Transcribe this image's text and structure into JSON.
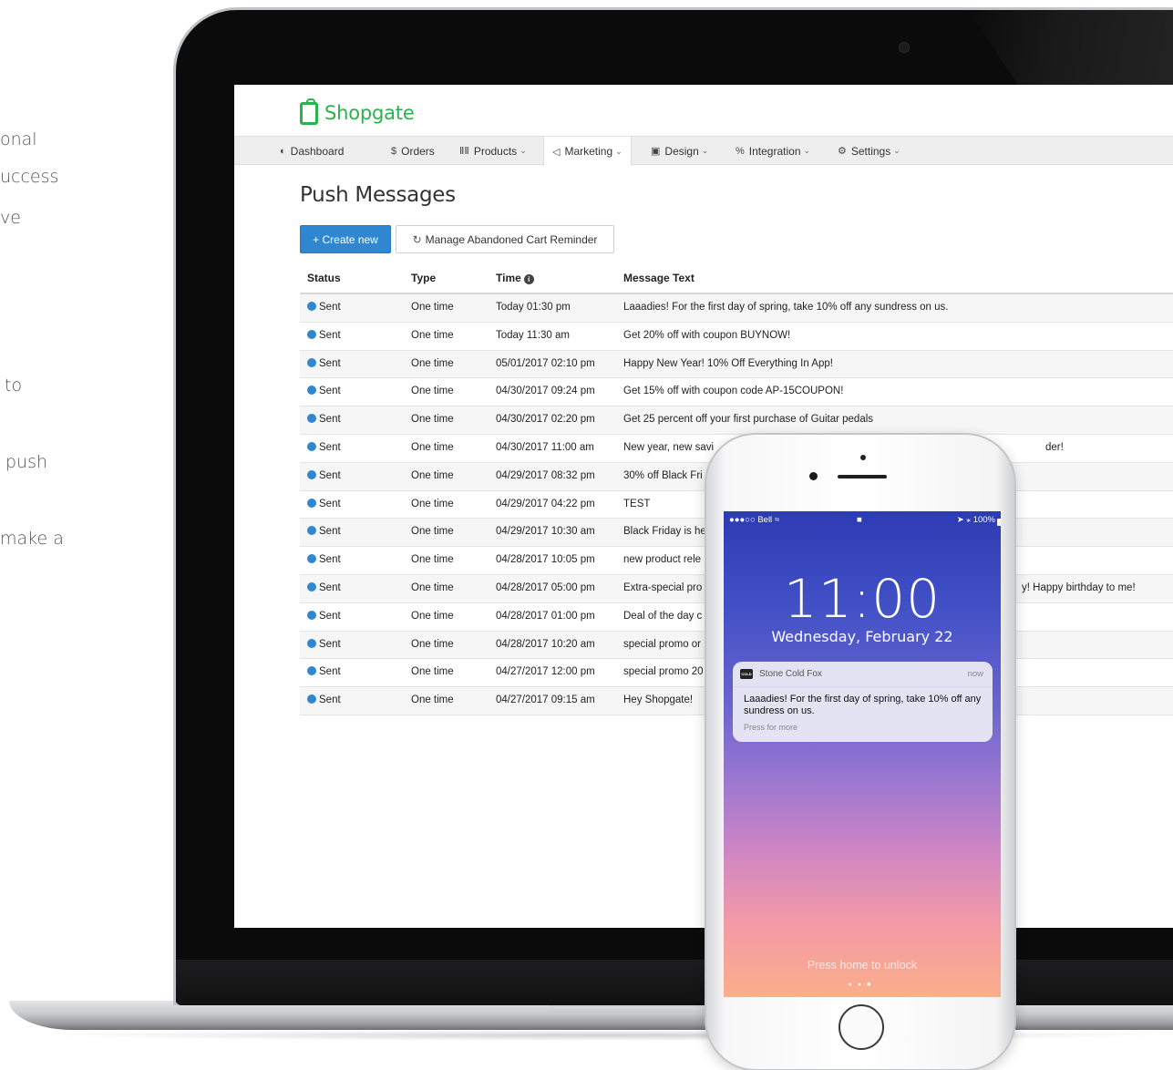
{
  "side_text": [
    "onal",
    "uccess",
    "ve",
    "to",
    "push",
    "make a"
  ],
  "app": {
    "brand": "Shopgate",
    "nav": [
      {
        "label": "Dashboard",
        "icon": "dashboard-icon",
        "glyph": "◐",
        "chevron": false
      },
      {
        "label": "Orders",
        "icon": "dollar-icon",
        "glyph": "$",
        "chevron": false
      },
      {
        "label": "Products",
        "icon": "barcode-icon",
        "glyph": "ⅡⅡ",
        "chevron": true
      },
      {
        "label": "Marketing",
        "icon": "megaphone-icon",
        "glyph": "◁",
        "chevron": true,
        "active": true
      },
      {
        "label": "Design",
        "icon": "image-icon",
        "glyph": "▣",
        "chevron": true
      },
      {
        "label": "Integration",
        "icon": "link-icon",
        "glyph": "%",
        "chevron": true
      },
      {
        "label": "Settings",
        "icon": "gears-icon",
        "glyph": "⚙",
        "chevron": true
      }
    ],
    "page_title": "Push Messages",
    "create_button": "+ Create new",
    "manage_button": "Manage Abandoned Cart Reminder",
    "columns": [
      "Status",
      "Type",
      "Time",
      "Message Text"
    ],
    "rows": [
      {
        "status": "Sent",
        "type": "One time",
        "time": "Today 01:30 pm",
        "message": "Laaadies! For the first day of spring, take 10% off any sundress on us."
      },
      {
        "status": "Sent",
        "type": "One time",
        "time": "Today 11:30 am",
        "message": "Get 20% off with coupon BUYNOW!"
      },
      {
        "status": "Sent",
        "type": "One time",
        "time": "05/01/2017 02:10 pm",
        "message": "Happy New Year! 10% Off Everything In App!"
      },
      {
        "status": "Sent",
        "type": "One time",
        "time": "04/30/2017 09:24 pm",
        "message": "Get 15% off with coupon code AP-15COUPON!"
      },
      {
        "status": "Sent",
        "type": "One time",
        "time": "04/30/2017 02:20 pm",
        "message": "Get 25 percent off your first purchase of Guitar pedals"
      },
      {
        "status": "Sent",
        "type": "One time",
        "time": "04/30/2017 11:00 am",
        "message": "New year, new savi",
        "message_tail": "der!"
      },
      {
        "status": "Sent",
        "type": "One time",
        "time": "04/29/2017 08:32 pm",
        "message": "30% off Black Fri"
      },
      {
        "status": "Sent",
        "type": "One time",
        "time": "04/29/2017 04:22 pm",
        "message": "TEST"
      },
      {
        "status": "Sent",
        "type": "One time",
        "time": "04/29/2017 10:30 am",
        "message": "Black Friday is he"
      },
      {
        "status": "Sent",
        "type": "One time",
        "time": "04/28/2017 10:05 pm",
        "message": "new product rele"
      },
      {
        "status": "Sent",
        "type": "One time",
        "time": "04/28/2017 05:00 pm",
        "message": "Extra-special pro",
        "message_tail": "y! Happy birthday to me!"
      },
      {
        "status": "Sent",
        "type": "One time",
        "time": "04/28/2017 01:00 pm",
        "message": "Deal of the day c"
      },
      {
        "status": "Sent",
        "type": "One time",
        "time": "04/28/2017 10:20 am",
        "message": "special promo or"
      },
      {
        "status": "Sent",
        "type": "One time",
        "time": "04/27/2017 12:00 pm",
        "message": "special promo 20"
      },
      {
        "status": "Sent",
        "type": "One time",
        "time": "04/27/2017 09:15 am",
        "message": "Hey Shopgate!"
      }
    ],
    "colors": {
      "brand_green": "#2bb24c",
      "primary_blue": "#2f87d1"
    }
  },
  "phone": {
    "carrier": "●●●○○ Bell",
    "battery": "100%",
    "time": "11:00",
    "date": "Wednesday, February 22",
    "notification": {
      "app": "Stone Cold Fox",
      "app_icon_text": "COLD",
      "time": "now",
      "body": "Laaadies! For the first day of spring, take 10% off any sundress on us.",
      "hint": "Press for more"
    },
    "unlock_text": "Press home to unlock"
  }
}
